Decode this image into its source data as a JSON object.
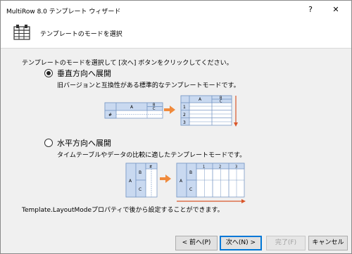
{
  "window": {
    "title": "MultiRow 8.0 テンプレート ウィザード",
    "help_label": "?",
    "close_label": "✕"
  },
  "header": {
    "title": "テンプレートのモードを選択"
  },
  "content": {
    "instruction": "テンプレートのモードを選択して [次へ] ボタンをクリックしてください。",
    "options": [
      {
        "label": "垂直方向へ展開",
        "description": "旧バージョンと互換性がある標準的なテンプレートモードです。",
        "checked": true
      },
      {
        "label": "水平方向へ展開",
        "description": "タイムテーブルやデータの比較に適したテンプレートモードです。",
        "checked": false
      }
    ],
    "vertical_illustration": {
      "left_cells": [
        "A",
        "B",
        "C"
      ],
      "left_row_header": "#",
      "right_cells": [
        "A",
        "B",
        "C"
      ],
      "row_numbers": [
        "1",
        "2",
        "3"
      ]
    },
    "horizontal_illustration": {
      "left_cells": [
        "A",
        "B",
        "C"
      ],
      "left_col_header": "#",
      "right_cells": [
        "A",
        "B",
        "C"
      ],
      "col_numbers": [
        "1",
        "2",
        "3"
      ]
    },
    "note": "Template.LayoutModeプロパティで後から設定することができます。"
  },
  "buttons": {
    "back": "< 前へ(P)",
    "next": "次へ(N) >",
    "finish": "完了(F)",
    "cancel": "キャンセル"
  },
  "colors": {
    "header_cell": "#c9d9f0",
    "arrow": "#f08a3c",
    "accent_line": "#d9562a"
  }
}
